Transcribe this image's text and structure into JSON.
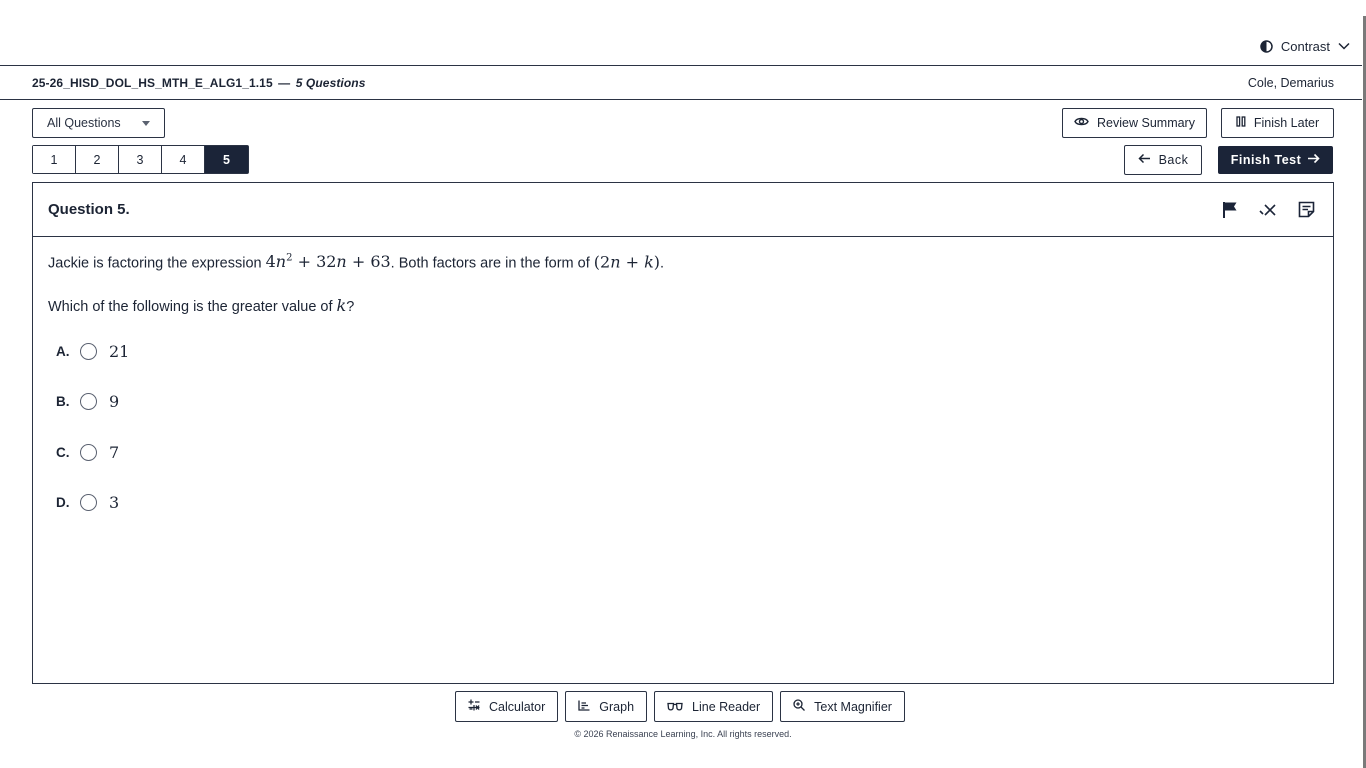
{
  "topbar": {
    "contrast_label": "Contrast"
  },
  "header": {
    "test_code": "25-26_HISD_DOL_HS_MTH_E_ALG1_1.15",
    "separator": "—",
    "question_count": "5 Questions",
    "student_name": "Cole, Demarius"
  },
  "controls": {
    "filter_selected": "All Questions",
    "question_numbers": [
      "1",
      "2",
      "3",
      "4",
      "5"
    ],
    "current_question": "5",
    "review_summary": "Review Summary",
    "finish_later": "Finish Later",
    "back": "Back",
    "finish_test": "Finish Test"
  },
  "question": {
    "title": "Question 5.",
    "stem_prefix": "Jackie is factoring the expression ",
    "expr_coef": "4",
    "expr_var": "n",
    "expr_exp": "2",
    "expr_rest_a": " + 32",
    "expr_rest_var": "n",
    "expr_rest_b": " + 63",
    "stem_middle": ". Both factors are in the form of ",
    "form_open": "(2",
    "form_var": "n",
    "form_plus": " + ",
    "form_k": "k",
    "form_close": ")",
    "stem_end": ".",
    "prompt_prefix": "Which of the following is the greater value of ",
    "prompt_var": "k",
    "prompt_suffix": "?",
    "choices": [
      {
        "letter": "A.",
        "value": "21"
      },
      {
        "letter": "B.",
        "value": "9"
      },
      {
        "letter": "C.",
        "value": "7"
      },
      {
        "letter": "D.",
        "value": "3"
      }
    ]
  },
  "icons": {
    "contrast": "half-circle-icon",
    "flag": "flag-icon",
    "eliminate": "answer-eliminator-icon",
    "notes": "notes-icon",
    "review": "eye-icon",
    "pause": "pause-icon",
    "back": "arrow-left-icon",
    "finish": "arrow-right-icon",
    "calculator": "calculator-icon",
    "graph": "graph-icon",
    "line_reader": "glasses-icon",
    "magnifier": "magnifier-icon"
  },
  "tools": {
    "calculator": "Calculator",
    "graph": "Graph",
    "line_reader": "Line Reader",
    "text_magnifier": "Text Magnifier"
  },
  "footer": {
    "copyright": "© 2026 Renaissance Learning, Inc. All rights reserved."
  },
  "colors": {
    "primary_dark": "#1b2438",
    "border": "#2b3344",
    "text": "#1c2434"
  }
}
